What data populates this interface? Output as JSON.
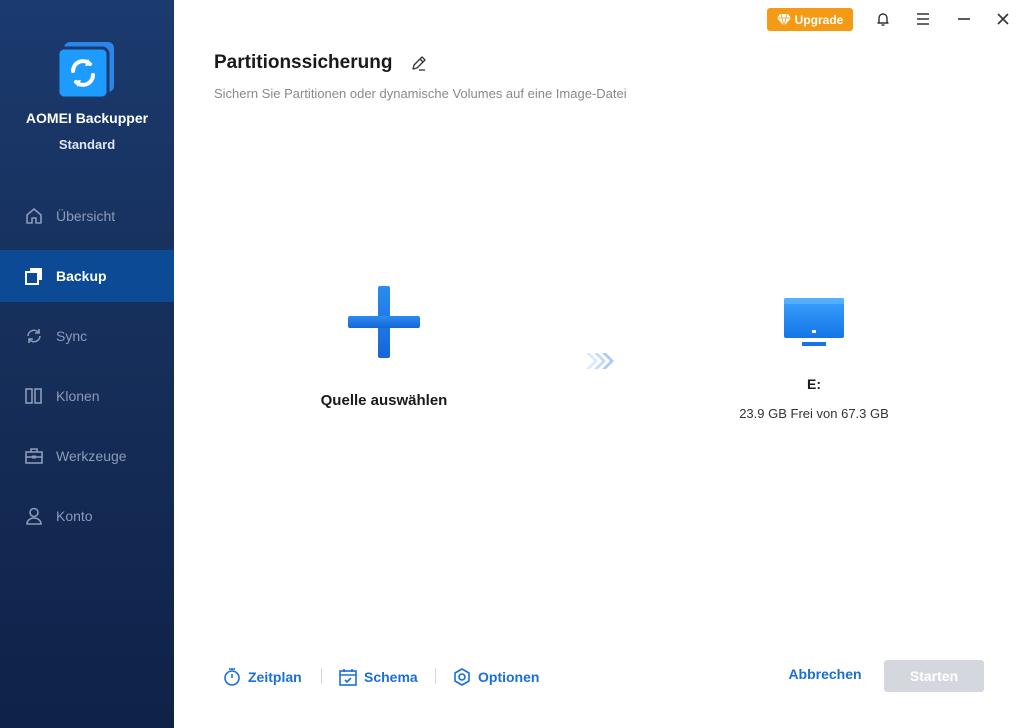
{
  "app": {
    "name": "AOMEI Backupper",
    "edition": "Standard"
  },
  "titlebar": {
    "upgrade_label": "Upgrade",
    "icons": [
      "bell-icon",
      "menu-icon",
      "minimize-icon",
      "close-icon"
    ]
  },
  "sidebar": {
    "items": [
      {
        "label": "Übersicht",
        "icon": "home-icon",
        "active": false
      },
      {
        "label": "Backup",
        "icon": "backup-icon",
        "active": true
      },
      {
        "label": "Sync",
        "icon": "sync-icon",
        "active": false
      },
      {
        "label": "Klonen",
        "icon": "clone-icon",
        "active": false
      },
      {
        "label": "Werkzeuge",
        "icon": "toolbox-icon",
        "active": false
      },
      {
        "label": "Konto",
        "icon": "user-icon",
        "active": false
      }
    ]
  },
  "header": {
    "title": "Partitionssicherung",
    "subtitle": "Sichern Sie Partitionen oder dynamische Volumes auf eine Image-Datei"
  },
  "main": {
    "source_label": "Quelle auswählen",
    "destination": {
      "drive": "E:",
      "space": "23.9 GB Frei von 67.3 GB"
    }
  },
  "bottom": {
    "schedule_label": "Zeitplan",
    "scheme_label": "Schema",
    "options_label": "Optionen",
    "cancel_label": "Abbrechen",
    "start_label": "Starten"
  },
  "colors": {
    "accent": "#1a6fd6",
    "sidebar": "#152d57",
    "sidebar_active": "#0d4a96",
    "upgrade": "#f59a15",
    "disabled": "#d4d8de"
  }
}
